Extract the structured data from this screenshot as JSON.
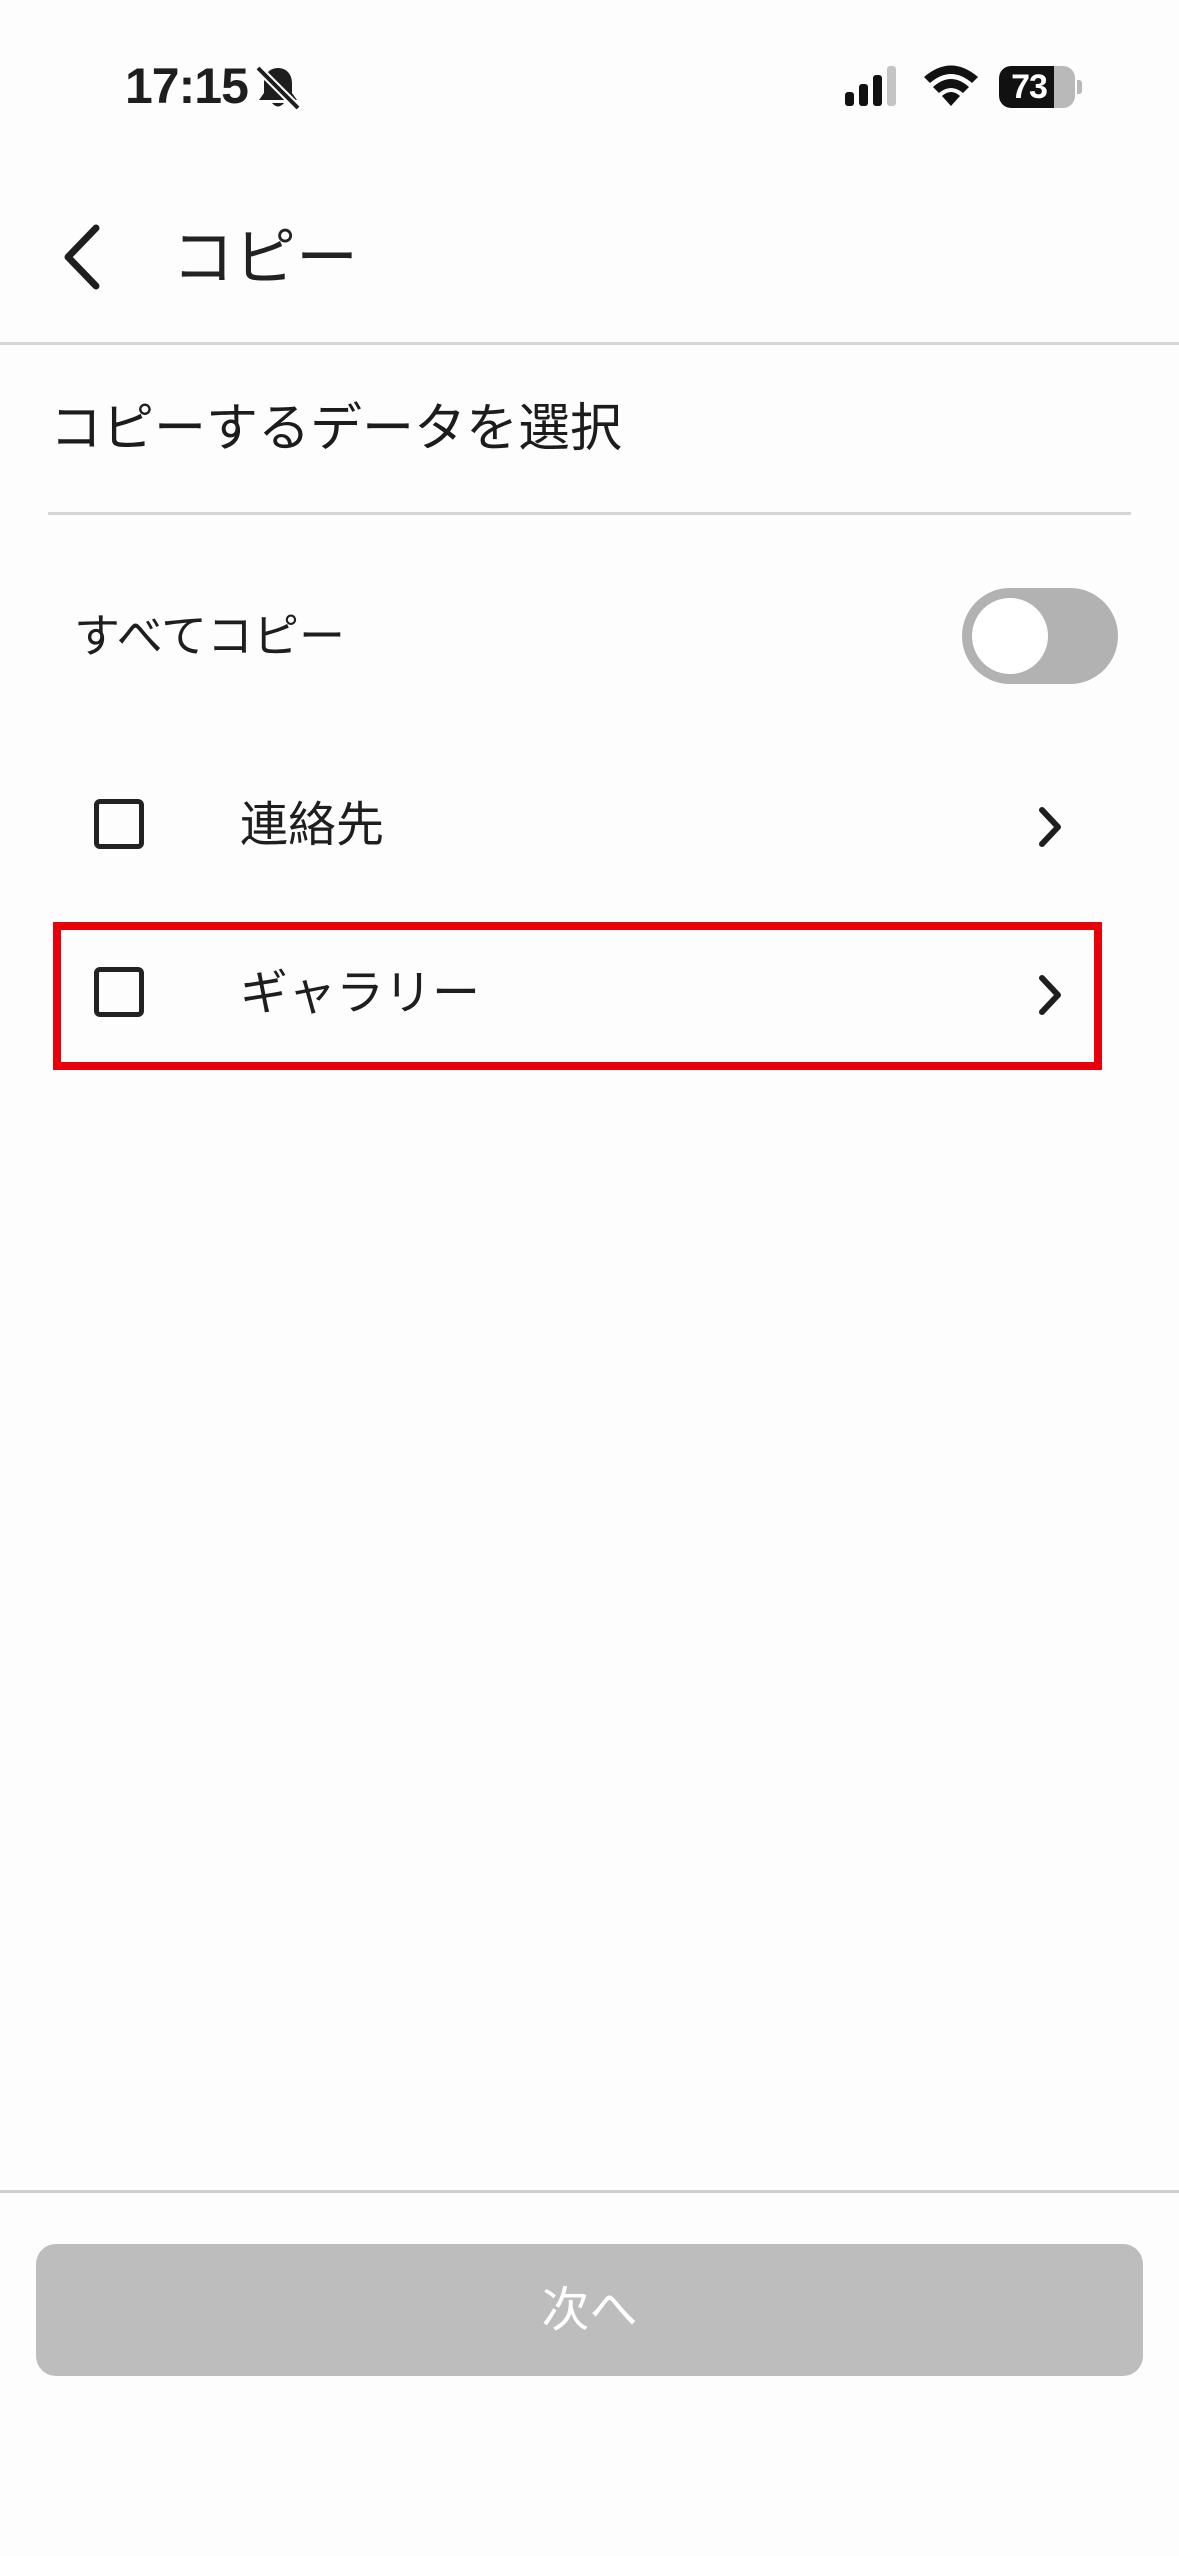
{
  "status_bar": {
    "time": "17:15",
    "battery_level": "73",
    "battery_fraction": 0.73,
    "icons": [
      "bell-slash-icon",
      "signal-icon",
      "wifi-icon",
      "battery-icon"
    ]
  },
  "header": {
    "back_icon": "chevron-left-icon",
    "title": "コピー"
  },
  "section": {
    "title": "コピーするデータを選択"
  },
  "copy_all": {
    "label": "すべてコピー",
    "enabled": false
  },
  "items": [
    {
      "label": "連絡先",
      "checked": false,
      "icon": "chevron-right-icon"
    },
    {
      "label": "ギャラリー",
      "checked": false,
      "icon": "chevron-right-icon",
      "highlighted": true
    }
  ],
  "footer": {
    "next_label": "次へ",
    "next_enabled": false
  },
  "colors": {
    "highlight": "#e8000b",
    "toggle_off": "#b2b2b2",
    "disabled_button": "#bdbdbd"
  }
}
